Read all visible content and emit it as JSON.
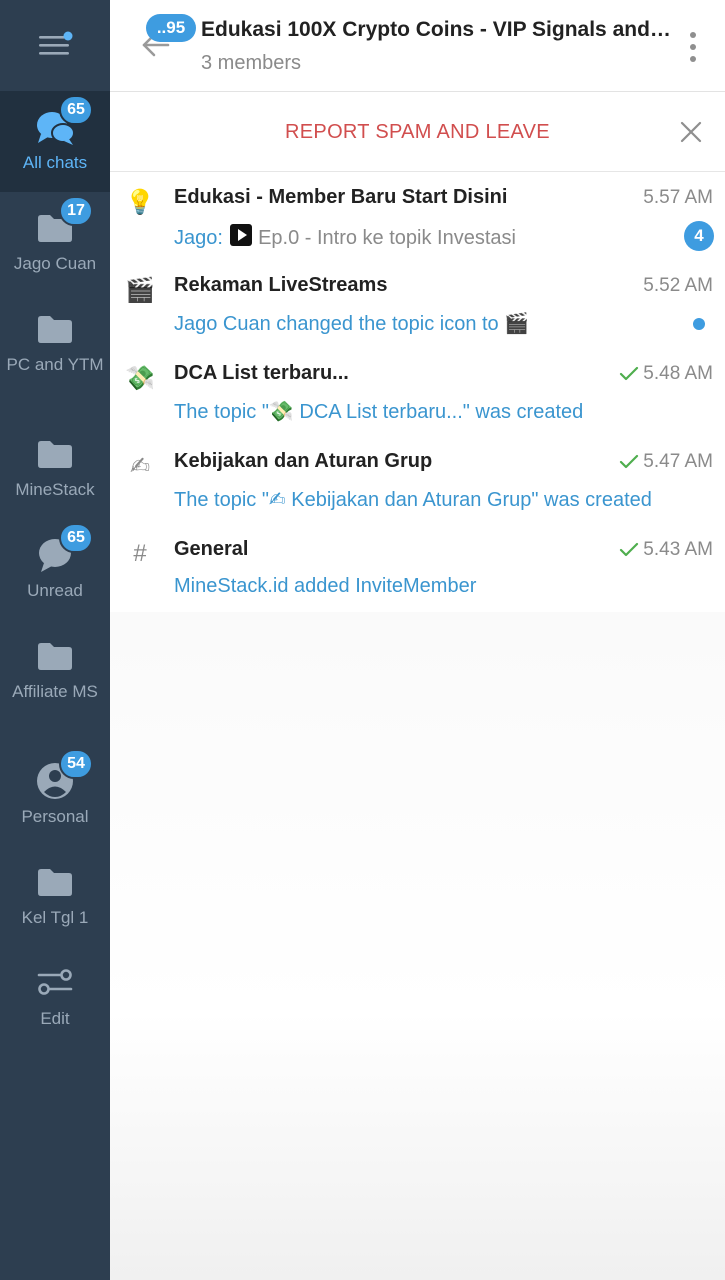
{
  "sidebar": {
    "folders": [
      {
        "label": "All chats",
        "badge": "65",
        "icon": "chats-icon",
        "active": true
      },
      {
        "label": "Jago Cuan",
        "badge": "17",
        "icon": "folder-icon"
      },
      {
        "label": "PC and YTM",
        "badge": "",
        "icon": "folder-icon"
      },
      {
        "label": "MineStack",
        "badge": "",
        "icon": "folder-icon"
      },
      {
        "label": "Unread",
        "badge": "65",
        "icon": "chat-bubble-icon"
      },
      {
        "label": "Affiliate MS",
        "badge": "",
        "icon": "folder-icon"
      },
      {
        "label": "Personal",
        "badge": "54",
        "icon": "person-icon"
      },
      {
        "label": "Kel Tgl 1",
        "badge": "",
        "icon": "folder-icon"
      },
      {
        "label": "Edit",
        "badge": "",
        "icon": "sliders-icon"
      }
    ]
  },
  "header": {
    "back_badge": "..95",
    "title": "Edukasi 100X Crypto Coins - VIP Signals and ...",
    "subtitle": "3 members"
  },
  "report": {
    "label": "REPORT SPAM AND LEAVE"
  },
  "topics": [
    {
      "icon": "💡",
      "name": "Edukasi - Member Baru Start Disini",
      "time": "5.57 AM",
      "sender": "Jago:",
      "message": "Ep.0 - Intro ke topik Investasi",
      "unread": "4"
    },
    {
      "icon": "🎬",
      "name": "Rekaman LiveStreams",
      "time": "5.52 AM",
      "message": "Jago Cuan changed the topic icon to 🎬"
    },
    {
      "icon": "💸",
      "name": "DCA List terbaru...",
      "time": "5.48 AM",
      "message": "The topic \"💸 DCA List terbaru...\" was created"
    },
    {
      "icon": "✍",
      "name": "Kebijakan dan Aturan Grup",
      "time": "5.47 AM",
      "message": "The topic \"✍ Kebijakan dan Aturan Grup\" was created"
    },
    {
      "icon": "#",
      "name": "General",
      "time": "5.43 AM",
      "message": "MineStack.id added InviteMember"
    }
  ],
  "colors": {
    "sidebar_bg": "#2d3e50",
    "accent": "#3e9ce0",
    "report_red": "#d14e4e",
    "check_green": "#4fae4e"
  }
}
